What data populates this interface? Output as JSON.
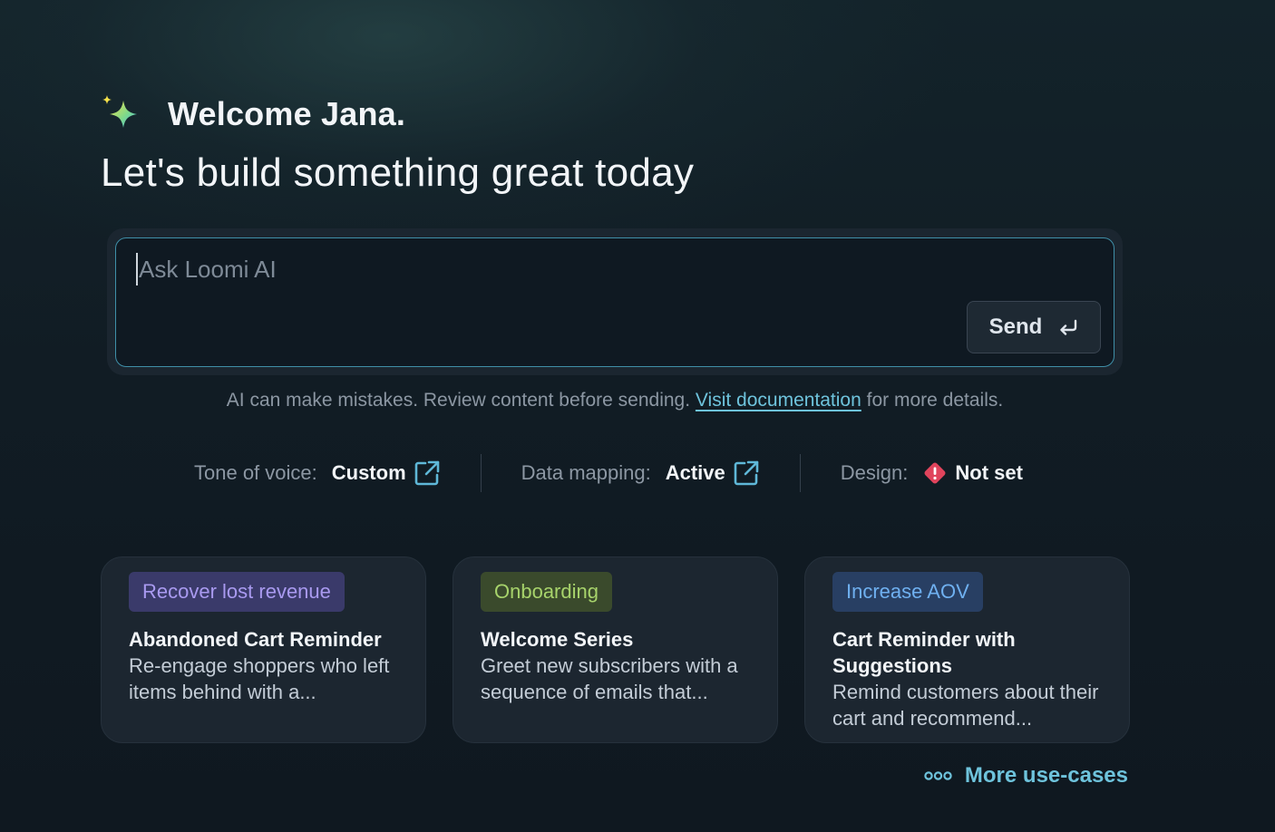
{
  "header": {
    "welcome": "Welcome Jana.",
    "subtitle": "Let's build something great today"
  },
  "prompt": {
    "placeholder": "Ask Loomi AI",
    "value": "",
    "send_label": "Send"
  },
  "disclaimer": {
    "before": "AI can make mistakes. Review content before sending.",
    "link": "Visit documentation",
    "after": "for more details."
  },
  "settings": [
    {
      "label": "Tone of voice:",
      "value": "Custom",
      "icon": "external-link-icon"
    },
    {
      "label": "Data mapping:",
      "value": "Active",
      "icon": "external-link-icon"
    },
    {
      "label": "Design:",
      "value": "Not set",
      "icon": "warning-diamond-icon"
    }
  ],
  "cards": [
    {
      "tag": "Recover lost revenue",
      "tag_color": "#a99af0",
      "title": "Abandoned Cart Reminder",
      "desc": "Re-engage shoppers who left items behind with a..."
    },
    {
      "tag": "Onboarding",
      "tag_color": "#a7d36b",
      "title": "Welcome Series",
      "desc": "Greet new subscribers with a sequence of emails that..."
    },
    {
      "tag": "Increase AOV",
      "tag_color": "#6fb0f0",
      "title": "Cart Reminder with Suggestions",
      "desc": "Remind customers about their cart and recommend..."
    }
  ],
  "more_link": "More use-cases",
  "colors": {
    "accent": "#6ec3dc",
    "warning": "#e0445c",
    "input_border": "#3f8fa8"
  }
}
